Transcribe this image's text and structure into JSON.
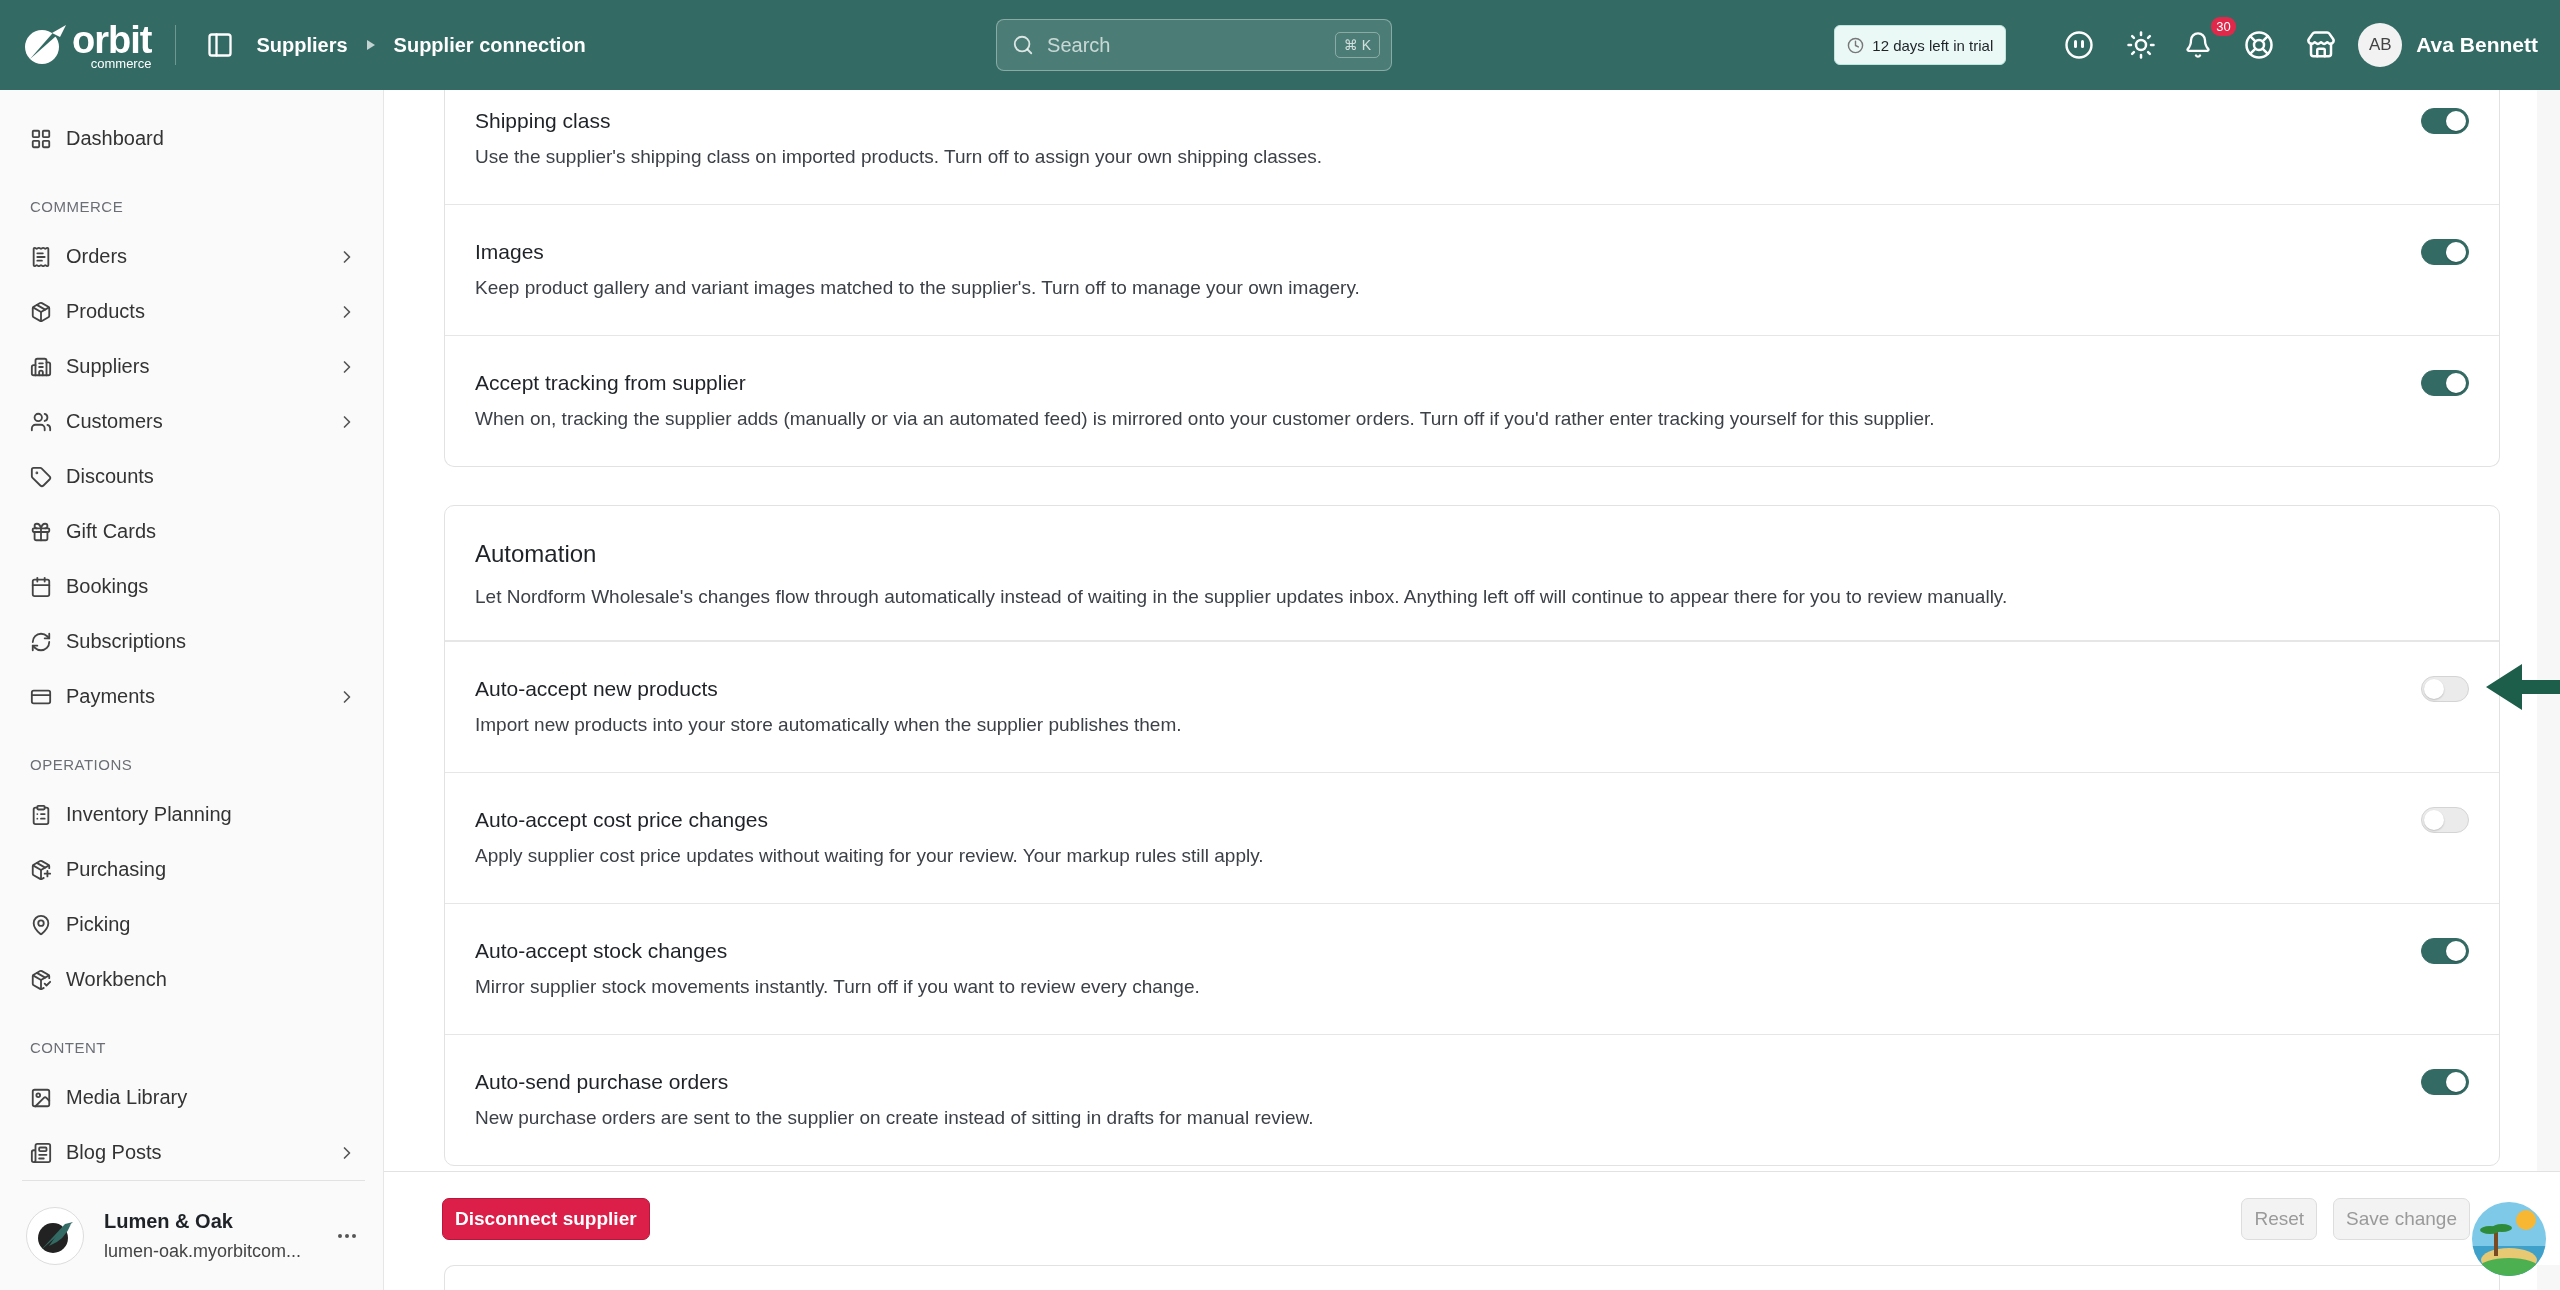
{
  "header": {
    "logo": {
      "name": "orbit",
      "tagline": "commerce"
    },
    "breadcrumb": [
      "Suppliers",
      "Supplier connection"
    ],
    "search": {
      "placeholder": "Search",
      "shortcut": "⌘ K"
    },
    "trial": "12 days left in trial",
    "notifications": "30",
    "user": {
      "initials": "AB",
      "name": "Ava Bennett"
    }
  },
  "sidebar": {
    "sections": [
      {
        "items": [
          {
            "label": "Dashboard",
            "expandable": false
          }
        ]
      },
      {
        "label": "COMMERCE",
        "items": [
          {
            "label": "Orders",
            "expandable": true
          },
          {
            "label": "Products",
            "expandable": true
          },
          {
            "label": "Suppliers",
            "expandable": true
          },
          {
            "label": "Customers",
            "expandable": true
          },
          {
            "label": "Discounts",
            "expandable": false
          },
          {
            "label": "Gift Cards",
            "expandable": false
          },
          {
            "label": "Bookings",
            "expandable": false
          },
          {
            "label": "Subscriptions",
            "expandable": false
          },
          {
            "label": "Payments",
            "expandable": true
          }
        ]
      },
      {
        "label": "OPERATIONS",
        "items": [
          {
            "label": "Inventory Planning",
            "expandable": false
          },
          {
            "label": "Purchasing",
            "expandable": false
          },
          {
            "label": "Picking",
            "expandable": false
          },
          {
            "label": "Workbench",
            "expandable": false
          }
        ]
      },
      {
        "label": "CONTENT",
        "items": [
          {
            "label": "Media Library",
            "expandable": false
          },
          {
            "label": "Blog Posts",
            "expandable": true
          }
        ]
      }
    ],
    "workspace": {
      "name": "Lumen & Oak",
      "domain": "lumen-oak.myorbitcom..."
    }
  },
  "cards": [
    {
      "settings": [
        {
          "title": "Shipping class",
          "description": "Use the supplier's shipping class on imported products. Turn off to assign your own shipping classes.",
          "on": true
        },
        {
          "title": "Images",
          "description": "Keep product gallery and variant images matched to the supplier's. Turn off to manage your own imagery.",
          "on": true
        },
        {
          "title": "Accept tracking from supplier",
          "description": "When on, tracking the supplier adds (manually or via an automated feed) is mirrored onto your customer orders. Turn off if you'd rather enter tracking yourself for this supplier.",
          "on": true
        }
      ]
    },
    {
      "title": "Automation",
      "description": "Let Nordform Wholesale's changes flow through automatically instead of waiting in the supplier updates inbox. Anything left off will continue to appear there for you to review manually.",
      "settings": [
        {
          "title": "Auto-accept new products",
          "description": "Import new products into your store automatically when the supplier publishes them.",
          "on": false
        },
        {
          "title": "Auto-accept cost price changes",
          "description": "Apply supplier cost price updates without waiting for your review. Your markup rules still apply.",
          "on": false
        },
        {
          "title": "Auto-accept stock changes",
          "description": "Mirror supplier stock movements instantly. Turn off if you want to review every change.",
          "on": true
        },
        {
          "title": "Auto-send purchase orders",
          "description": "New purchase orders are sent to the supplier on create instead of sitting in drafts for manual review.",
          "on": true
        }
      ]
    }
  ],
  "footer": {
    "disconnect": "Disconnect supplier",
    "reset": {
      "label": "Reset",
      "disabled": true
    },
    "save": {
      "label": "Save change",
      "disabled": true
    }
  }
}
